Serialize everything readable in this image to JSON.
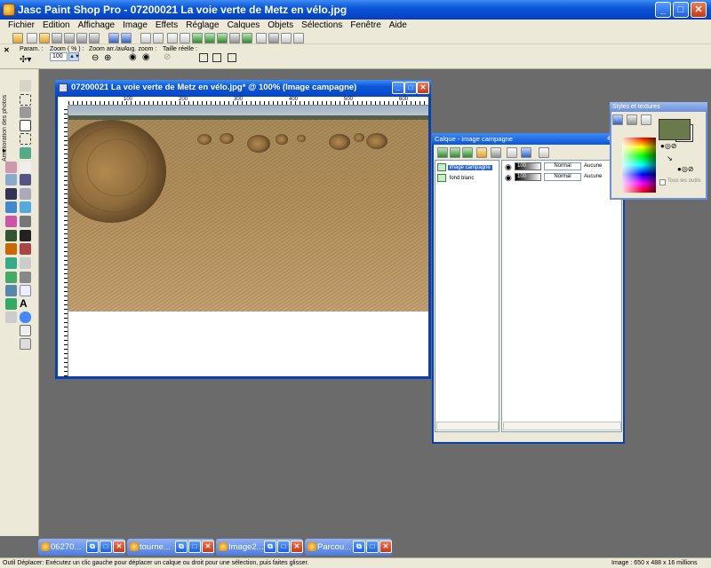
{
  "app": {
    "title": "Jasc Paint Shop Pro - 07200021 La voie verte de Metz en vélo.jpg"
  },
  "menu": [
    "Fichier",
    "Edition",
    "Affichage",
    "Image",
    "Effets",
    "Réglage",
    "Calques",
    "Objets",
    "Sélections",
    "Fenêtre",
    "Aide"
  ],
  "toolbar2": {
    "param_label": "Param. :",
    "zoom_label": "Zoom ( % ) :",
    "zoom_value": "100",
    "zoomav_label": "Zoom arr./av. :",
    "augzoom_label": "Aug. zoom :",
    "taille_label": "Taille réelle :"
  },
  "palette": {
    "vertical_label": "Amélioration des photos"
  },
  "image_window": {
    "title": "07200021 La voie verte de Metz en vélo.jpg* @ 100% (Image campagne)",
    "ruler_marks": [
      "100",
      "200",
      "300",
      "400",
      "500",
      "600"
    ]
  },
  "layers": {
    "title": "Calque - image campagne",
    "items": [
      {
        "name": "image campagne",
        "opacity": "100",
        "blend": "Normal",
        "link": "Aucune"
      },
      {
        "name": "fond blanc",
        "opacity": "100",
        "blend": "Normal",
        "link": "Aucune"
      }
    ]
  },
  "styles": {
    "title": "Styles et textures",
    "all_tools_label": "Tous les outils",
    "fg_color": "#6b7a4a"
  },
  "taskbar": [
    {
      "label": "06270..."
    },
    {
      "label": "tourne..."
    },
    {
      "label": "Image2..."
    },
    {
      "label": "Parcou..."
    }
  ],
  "status": {
    "left": "Outil Déplacer: Exécutez un clic gauche pour déplacer un calque ou droit pour une sélection, puis faites glisser.",
    "right": "Image : 650 x 488 x 16 millions"
  }
}
